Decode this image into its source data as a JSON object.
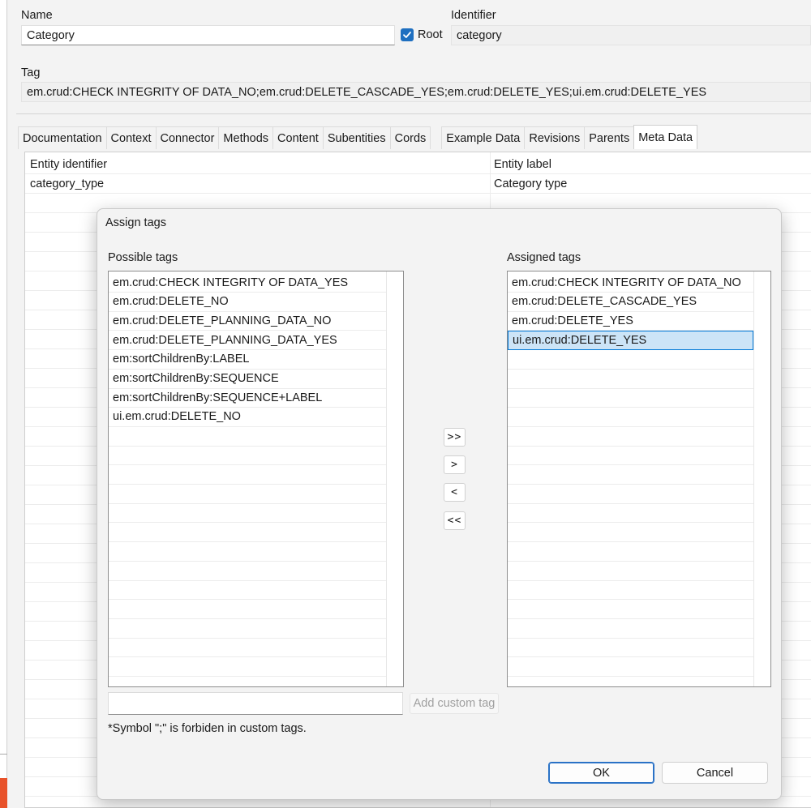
{
  "form": {
    "name_label": "Name",
    "name_value": "Category",
    "root_label": "Root",
    "root_checked": true,
    "identifier_label": "Identifier",
    "identifier_value": "category",
    "tag_label": "Tag",
    "tag_value": "em.crud:CHECK INTEGRITY OF DATA_NO;em.crud:DELETE_CASCADE_YES;em.crud:DELETE_YES;ui.em.crud:DELETE_YES"
  },
  "tabs": [
    {
      "label": "Documentation"
    },
    {
      "label": "Context"
    },
    {
      "label": "Connector"
    },
    {
      "label": "Methods"
    },
    {
      "label": "Content"
    },
    {
      "label": "Subentities"
    },
    {
      "label": "Cords"
    },
    {
      "label": "Example Data"
    },
    {
      "label": "Revisions"
    },
    {
      "label": "Parents"
    },
    {
      "label": "Meta Data"
    }
  ],
  "active_tab": "Meta Data",
  "meta": {
    "col1_header": "Entity identifier",
    "col2_header": "Entity label",
    "col1_value": "category_type",
    "col2_value": "Category type"
  },
  "dialog": {
    "title": "Assign tags",
    "possible_label": "Possible tags",
    "assigned_label": "Assigned tags",
    "possible_tags": [
      "em.crud:CHECK INTEGRITY OF DATA_YES",
      "em.crud:DELETE_NO",
      "em.crud:DELETE_PLANNING_DATA_NO",
      "em.crud:DELETE_PLANNING_DATA_YES",
      "em:sortChildrenBy:LABEL",
      "em:sortChildrenBy:SEQUENCE",
      "em:sortChildrenBy:SEQUENCE+LABEL",
      "ui.em.crud:DELETE_NO"
    ],
    "assigned_tags": [
      "em.crud:CHECK INTEGRITY OF DATA_NO",
      "em.crud:DELETE_CASCADE_YES",
      "em.crud:DELETE_YES",
      "ui.em.crud:DELETE_YES"
    ],
    "selected_assigned": "ui.em.crud:DELETE_YES",
    "move_all_right": ">>",
    "move_right": ">",
    "move_left": "<",
    "move_all_left": "<<",
    "custom_tag_value": "",
    "add_custom_label": "Add custom tag",
    "note": "*Symbol \";\" is forbiden in custom tags.",
    "ok_label": "OK",
    "cancel_label": "Cancel"
  },
  "colors": {
    "accent": "#1e6fc0",
    "selection_bg": "#cce4f7",
    "selection_border": "#0078d7"
  }
}
